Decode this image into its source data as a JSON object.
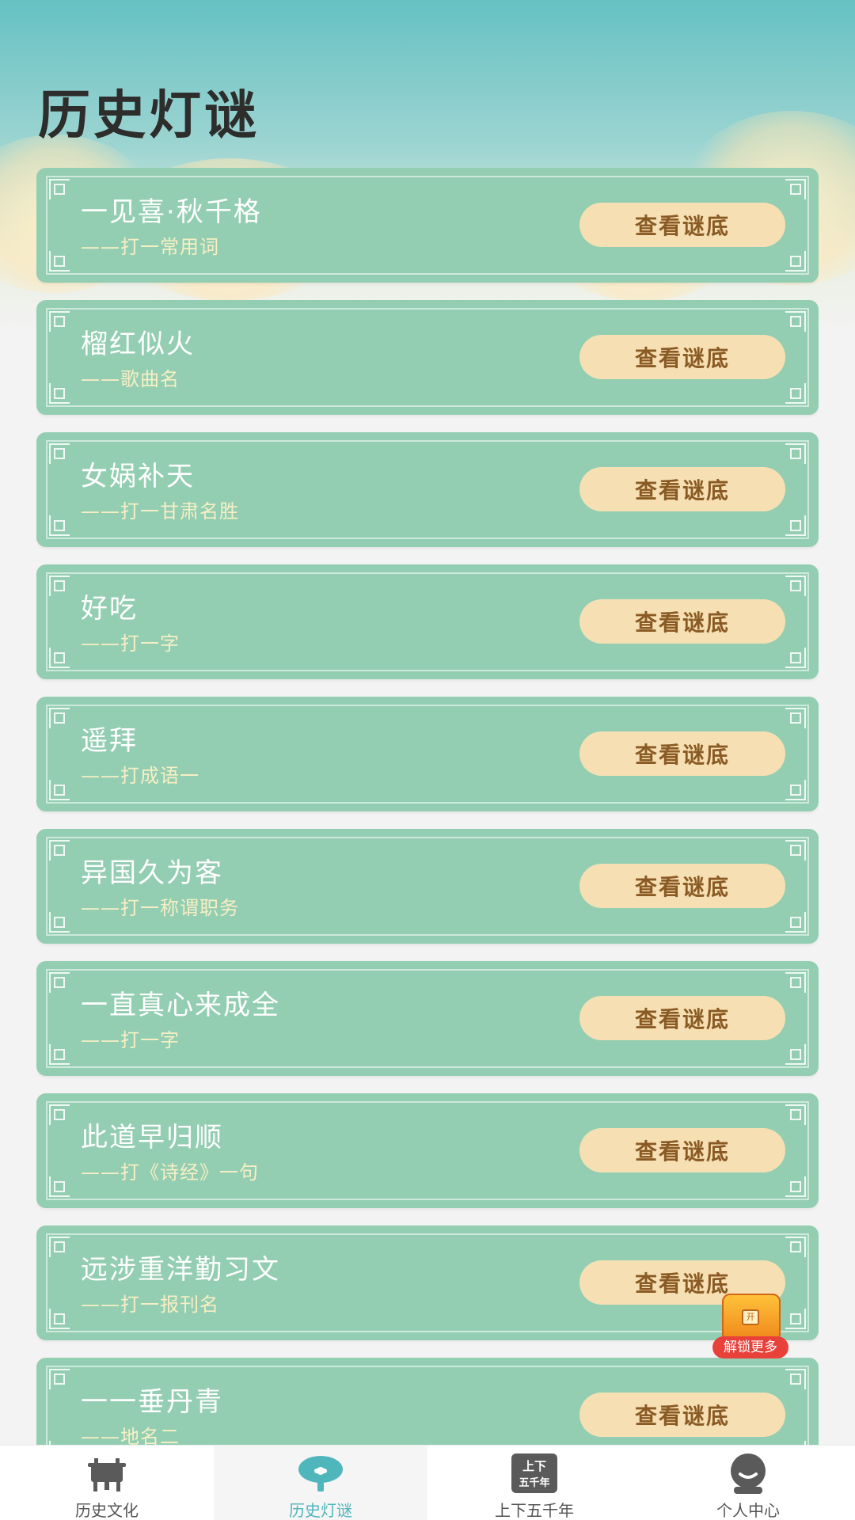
{
  "header": {
    "title": "历史灯谜"
  },
  "riddles": [
    {
      "text": "一见喜·秋千格",
      "hint": "——打一常用词",
      "button": "查看谜底"
    },
    {
      "text": "榴红似火",
      "hint": "——歌曲名",
      "button": "查看谜底"
    },
    {
      "text": "女娲补天",
      "hint": "——打一甘肃名胜",
      "button": "查看谜底"
    },
    {
      "text": "好吃",
      "hint": "——打一字",
      "button": "查看谜底"
    },
    {
      "text": "遥拜",
      "hint": "——打成语一",
      "button": "查看谜底"
    },
    {
      "text": "异国久为客",
      "hint": "——打一称谓职务",
      "button": "查看谜底"
    },
    {
      "text": "一直真心来成全",
      "hint": "——打一字",
      "button": "查看谜底"
    },
    {
      "text": "此道早归顺",
      "hint": "——打《诗经》一句",
      "button": "查看谜底"
    },
    {
      "text": "远涉重洋勤习文",
      "hint": "——打一报刊名",
      "button": "查看谜底"
    },
    {
      "text": "一一垂丹青",
      "hint": "——地名二",
      "button": "查看谜底"
    }
  ],
  "floating_badge": {
    "label": "解锁更多",
    "lock_char": "开"
  },
  "tabbar": {
    "tabs": [
      {
        "label": "历史文化",
        "icon": "bronze-ding-icon"
      },
      {
        "label": "历史灯谜",
        "icon": "lantern-icon"
      },
      {
        "label": "上下五千年",
        "icon": "calendar-block-icon",
        "icon_text_top": "上下",
        "icon_text_bottom": "五千年"
      },
      {
        "label": "个人中心",
        "icon": "person-icon"
      }
    ],
    "active_index": 1
  },
  "colors": {
    "card": "#93ceb2",
    "button": "#f6e0b3",
    "button_text": "#8a5a24",
    "hint_text": "#f7efc4",
    "active_tab": "#4fb6bb"
  }
}
